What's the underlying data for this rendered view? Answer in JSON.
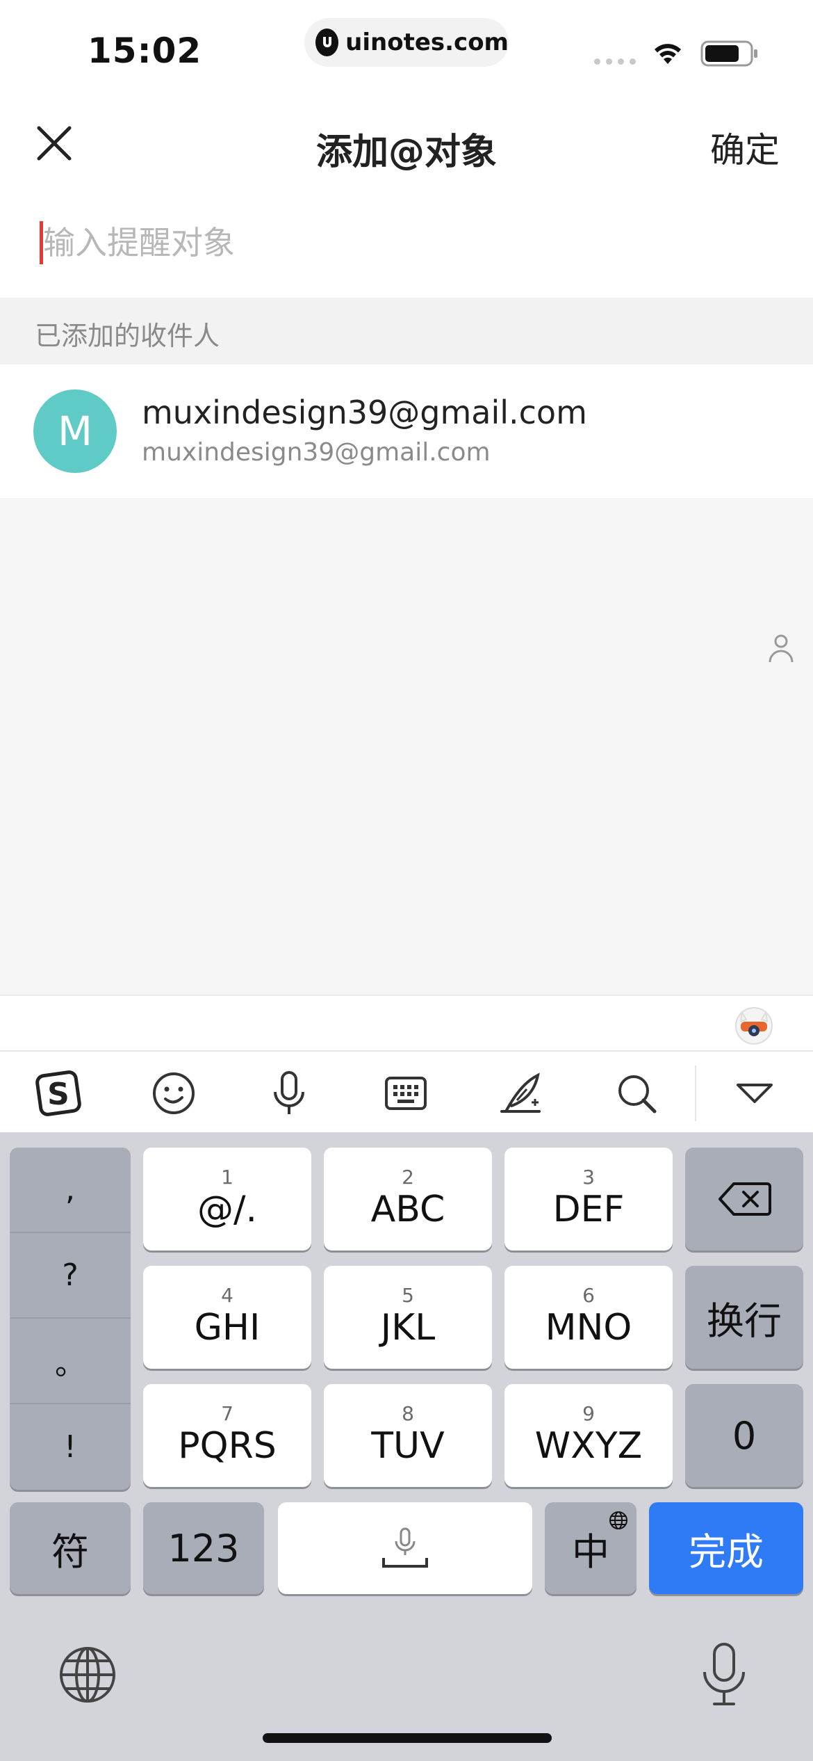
{
  "status_bar": {
    "time": "15:02",
    "url": "uinotes.com"
  },
  "nav": {
    "title": "添加@对象",
    "confirm_label": "确定"
  },
  "search": {
    "placeholder": "输入提醒对象",
    "value": ""
  },
  "section": {
    "label": "已添加的收件人"
  },
  "recipients": [
    {
      "initial": "M",
      "name": "muxindesign39@gmail.com",
      "email": "muxindesign39@gmail.com"
    }
  ],
  "colors": {
    "avatar": "#5fcac6",
    "cursor": "#e53935",
    "done_key": "#2f7bf6"
  },
  "keyboard": {
    "toolbar_icons": [
      "sogou-logo-icon",
      "emoji-icon",
      "microphone-icon",
      "keyboard-icon",
      "handwriting-icon",
      "search-icon",
      "collapse-icon"
    ],
    "punctuation": [
      ",",
      "?",
      "。",
      "!"
    ],
    "keys": [
      {
        "digit": "1",
        "label": "@/."
      },
      {
        "digit": "2",
        "label": "ABC"
      },
      {
        "digit": "3",
        "label": "DEF"
      },
      {
        "digit": "4",
        "label": "GHI"
      },
      {
        "digit": "5",
        "label": "JKL"
      },
      {
        "digit": "6",
        "label": "MNO"
      },
      {
        "digit": "7",
        "label": "PQRS"
      },
      {
        "digit": "8",
        "label": "TUV"
      },
      {
        "digit": "9",
        "label": "WXYZ"
      }
    ],
    "newline_label": "换行",
    "zero_label": "0",
    "symbols_label": "符",
    "numbers_label": "123",
    "chinese_label": "中",
    "done_label": "完成"
  }
}
